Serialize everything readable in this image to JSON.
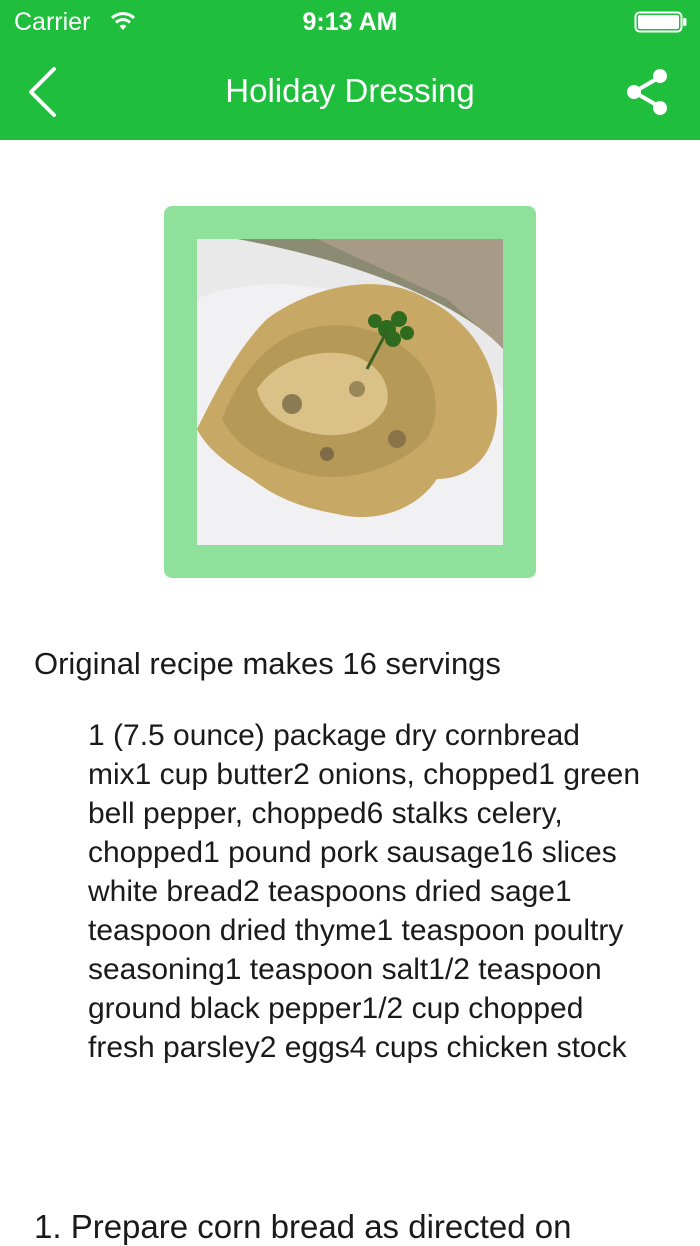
{
  "status_bar": {
    "carrier": "Carrier",
    "time": "9:13 AM"
  },
  "nav": {
    "title": "Holiday Dressing",
    "back_icon": "chevron-left-icon",
    "share_icon": "share-icon",
    "bar_color": "#1fbf3d"
  },
  "recipe": {
    "photo_frame_color": "#8fe09a",
    "servings": "Original recipe makes 16 servings",
    "ingredients": "1 (7.5 ounce) package dry cornbread mix1 cup butter2 onions, chopped1 green bell pepper, chopped6 stalks celery, chopped1 pound pork sausage16 slices white bread2 teaspoons dried sage1 teaspoon dried thyme1 teaspoon poultry seasoning1 teaspoon salt1/2 teaspoon ground black pepper1/2 cup chopped fresh parsley2 eggs4 cups chicken stock",
    "first_step": "1. Prepare corn bread as directed on"
  }
}
